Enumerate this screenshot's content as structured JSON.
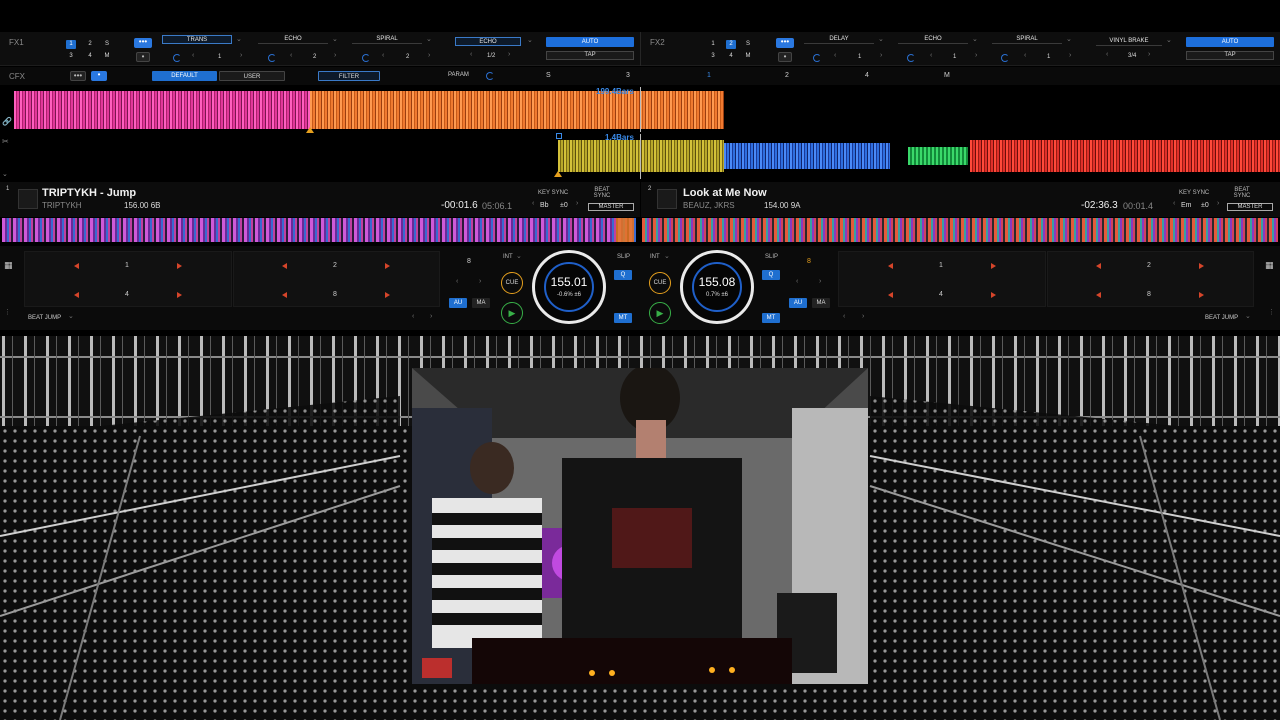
{
  "fx1": {
    "label": "FX1",
    "assign": [
      "1",
      "2",
      "S",
      "3",
      "4",
      "M"
    ],
    "effects": [
      "TRANS",
      "ECHO",
      "SPIRAL"
    ],
    "effect_values": [
      "1",
      "2",
      "2"
    ],
    "beat_effect": "ECHO",
    "beat_value": "1/2",
    "auto_label": "AUTO",
    "tap_label": "TAP"
  },
  "fx2": {
    "label": "FX2",
    "assign": [
      "1",
      "2",
      "S",
      "3",
      "4",
      "M"
    ],
    "effects": [
      "DELAY",
      "ECHO",
      "SPIRAL"
    ],
    "effect_values": [
      "1",
      "1",
      "1"
    ],
    "beat_effect": "VINYL BRAKE",
    "beat_value": "3/4",
    "auto_label": "AUTO",
    "tap_label": "TAP"
  },
  "cfx": {
    "label": "CFX",
    "default_label": "DEFAULT",
    "user_label": "USER",
    "filter_label": "FILTER",
    "param_label": "PARAM",
    "s_label": "S",
    "num3": "3",
    "num1": "1",
    "num2": "2",
    "num4": "4",
    "m_label": "M"
  },
  "overview": {
    "deck1_bars": "199.4Bars",
    "deck2_bars": "1.4Bars"
  },
  "deck1": {
    "number": "1",
    "title": "TRIPTYKH - Jump",
    "artist": "TRIPTYKH",
    "bpm_key": "156.00 6B",
    "elapsed": "-00:01.6",
    "remaining": "05:06.1",
    "key_sync": "KEY SYNC",
    "beat_sync": "BEAT SYNC",
    "key": "Bb",
    "key_offset": "±0",
    "master": "MASTER",
    "jog_bpm": "155.01",
    "jog_pct": "-0.6% ±6",
    "loop_beats": "8",
    "int_label": "INT",
    "slip_label": "SLIP",
    "q_label": "Q",
    "cue_label": "CUE",
    "au_label": "AU",
    "ma_label": "MA",
    "mt_label": "MT",
    "pads": [
      "1",
      "2",
      "4",
      "8"
    ],
    "pad_mode": "BEAT JUMP"
  },
  "deck2": {
    "number": "2",
    "title": "Look at Me Now",
    "artist": "BEAUZ, JKRS",
    "bpm_key": "154.00 9A",
    "elapsed": "-02:36.3",
    "remaining": "00:01.4",
    "key_sync": "KEY SYNC",
    "beat_sync": "BEAT SYNC",
    "key": "Em",
    "key_offset": "±0",
    "master": "MASTER",
    "jog_bpm": "155.08",
    "jog_pct": "0.7% ±6",
    "loop_beats": "8",
    "int_label": "INT",
    "slip_label": "SLIP",
    "q_label": "Q",
    "cue_label": "CUE",
    "au_label": "AU",
    "ma_label": "MA",
    "mt_label": "MT",
    "pads": [
      "1",
      "2",
      "4",
      "8"
    ],
    "pad_mode": "BEAT JUMP"
  },
  "colors": {
    "accent": "#1f6fd0",
    "deck1_wave_a": "#e2389a",
    "deck1_wave_b": "#f07a30",
    "deck2_wave_yellow": "#b8a82a",
    "deck2_wave_blue": "#2f6fe0",
    "deck2_wave_red": "#e0302a",
    "cue_orange": "#e6a01e",
    "play_green": "#38b048"
  }
}
